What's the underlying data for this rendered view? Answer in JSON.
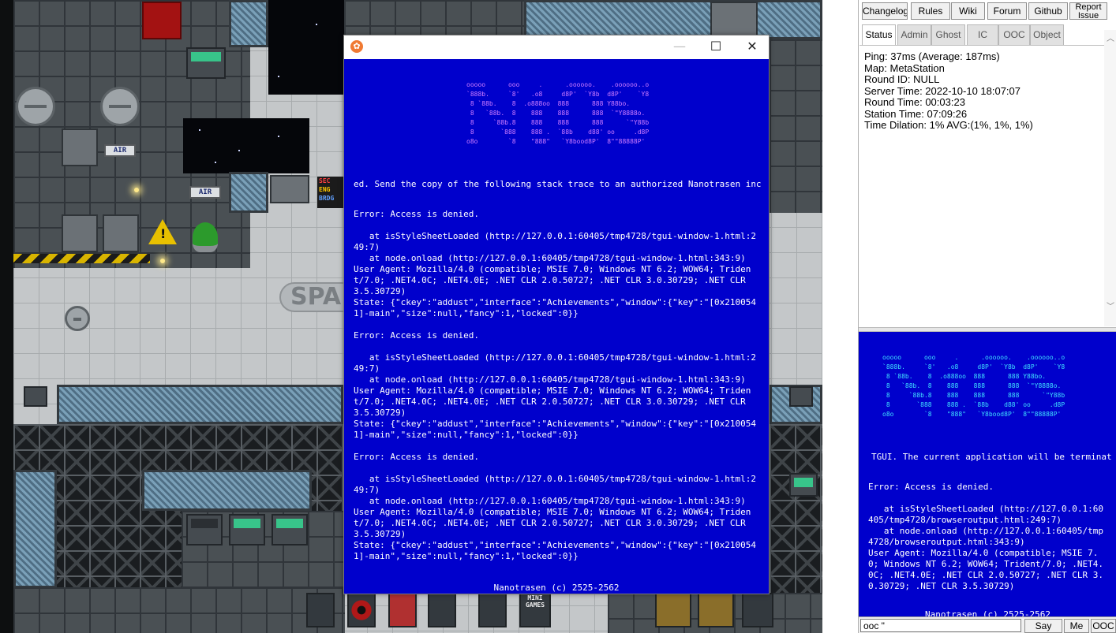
{
  "popup": {
    "title": "",
    "banner": "ooooo      ooo     .      .oooooo.    .oooooo..o\n`888b.     `8'   .o8     d8P'  `Y8b  d8P'    `Y8\n 8 `88b.    8  .o888oo  888      888 Y88bo.\n 8   `88b.  8    888    888      888  `\"Y8888o.\n 8     `88b.8    888    888      888      `\"Y88b\n 8       `888    888 .  `88b    d88' oo     .d8P\no8o        `8    \"888\"   `Y8bood8P'  8\"\"88888P'",
    "lead": "ed. Send the copy of the following stack trace to an authorized Nanotrasen inc",
    "errors": [
      {
        "error": "Error: Access is denied.",
        "at1": "   at isStyleSheetLoaded (http://127.0.0.1:60405/tmp4728/tgui-window-1.html:249:7)",
        "at2": "   at node.onload (http://127.0.0.1:60405/tmp4728/tgui-window-1.html:343:9)",
        "ua": "User Agent: Mozilla/4.0 (compatible; MSIE 7.0; Windows NT 6.2; WOW64; Trident/7.0; .NET4.0C; .NET4.0E; .NET CLR 2.0.50727; .NET CLR 3.0.30729; .NET CLR 3.5.30729)",
        "state": "State: {\"ckey\":\"addust\",\"interface\":\"Achievements\",\"window\":{\"key\":\"[0x2100541]-main\",\"size\":null,\"fancy\":1,\"locked\":0}}"
      },
      {
        "error": "Error: Access is denied.",
        "at1": "   at isStyleSheetLoaded (http://127.0.0.1:60405/tmp4728/tgui-window-1.html:249:7)",
        "at2": "   at node.onload (http://127.0.0.1:60405/tmp4728/tgui-window-1.html:343:9)",
        "ua": "User Agent: Mozilla/4.0 (compatible; MSIE 7.0; Windows NT 6.2; WOW64; Trident/7.0; .NET4.0C; .NET4.0E; .NET CLR 2.0.50727; .NET CLR 3.0.30729; .NET CLR 3.5.30729)",
        "state": "State: {\"ckey\":\"addust\",\"interface\":\"Achievements\",\"window\":{\"key\":\"[0x2100541]-main\",\"size\":null,\"fancy\":1,\"locked\":0}}"
      },
      {
        "error": "Error: Access is denied.",
        "at1": "   at isStyleSheetLoaded (http://127.0.0.1:60405/tmp4728/tgui-window-1.html:249:7)",
        "at2": "   at node.onload (http://127.0.0.1:60405/tmp4728/tgui-window-1.html:343:9)",
        "ua": "User Agent: Mozilla/4.0 (compatible; MSIE 7.0; Windows NT 6.2; WOW64; Trident/7.0; .NET4.0C; .NET4.0E; .NET CLR 2.0.50727; .NET CLR 3.0.30729; .NET CLR 3.5.30729)",
        "state": "State: {\"ckey\":\"addust\",\"interface\":\"Achievements\",\"window\":{\"key\":\"[0x2100541]-main\",\"size\":null,\"fancy\":1,\"locked\":0}}"
      }
    ],
    "footer": "Nanotrasen (c) 2525-2562",
    "minimize_glyph": "—",
    "maximize_glyph": "☐",
    "close_glyph": "✕"
  },
  "map": {
    "signs": {
      "air": "AIR",
      "sec": "SEC",
      "eng": "ENG",
      "brdg": "BRDG"
    },
    "spa_label": "SPA",
    "hotbar_minigames": "MINI\nGAMES"
  },
  "panel": {
    "links": [
      "Changelog",
      "Rules",
      "Wiki",
      "Forum",
      "Github",
      "Report Issue"
    ],
    "tabs": [
      "Status",
      "Admin",
      "Ghost",
      "IC",
      "OOC",
      "Object"
    ],
    "active_tab": "Status",
    "status": {
      "ping": "Ping: 37ms (Average: 187ms)",
      "map": "Map: MetaStation",
      "round_id": "Round ID: NULL",
      "server_time": "Server Time: 2022-10-10 18:07:07",
      "round_time": "Round Time: 00:03:23",
      "station_time": "Station Time: 07:09:26",
      "time_dilation": "Time Dilation: 1% AVG:(1%, 1%, 1%)"
    },
    "output": {
      "lead": "TGUI. The current application will be terminat",
      "error": "Error: Access is denied.",
      "at1": "   at isStyleSheetLoaded (http://127.0.0.1:60405/tmp4728/browseroutput.html:249:7)",
      "at2": "   at node.onload (http://127.0.0.1:60405/tmp4728/browseroutput.html:343:9)",
      "ua": "User Agent: Mozilla/4.0 (compatible; MSIE 7.0; Windows NT 6.2; WOW64; Trident/7.0; .NET4.0C; .NET4.0E; .NET CLR 2.0.50727; .NET CLR 3.0.30729; .NET CLR 3.5.30729)",
      "footer": "Nanotrasen (c) 2525-2562"
    },
    "input": {
      "value": "ooc \""
    },
    "buttons": {
      "say": "Say",
      "me": "Me",
      "ooc": "OOC"
    }
  },
  "colors": {
    "bsod_blue": "#0000cc",
    "banner_pink": "#d07cff",
    "banner_cyan": "#3fe0ff"
  }
}
